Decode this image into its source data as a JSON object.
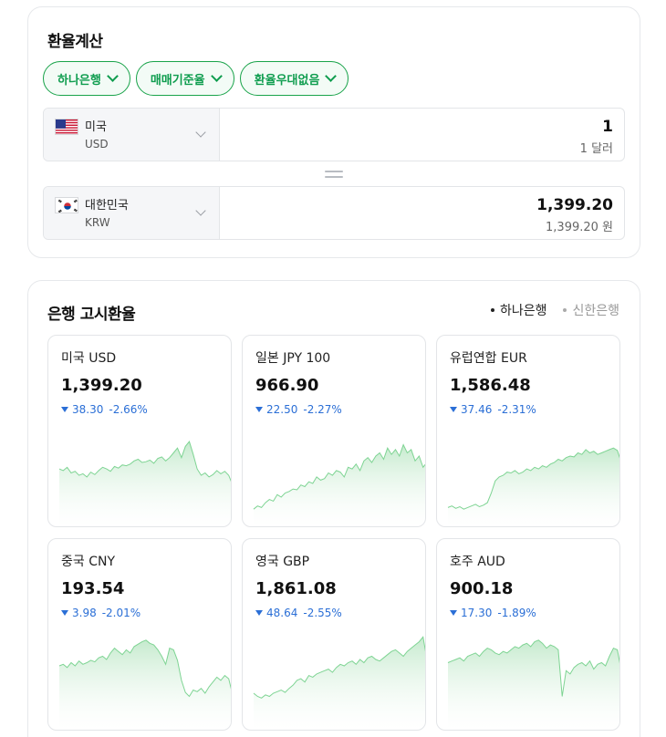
{
  "calculator": {
    "title": "환율계산",
    "chips": [
      "하나은행",
      "매매기준율",
      "환율우대없음"
    ],
    "from": {
      "name": "미국",
      "code": "USD",
      "amount": "1",
      "amount_text": "1 달러"
    },
    "to": {
      "name": "대한민국",
      "code": "KRW",
      "amount": "1,399.20",
      "amount_text": "1,399.20 원"
    }
  },
  "rates": {
    "title": "은행 고시환율",
    "banks": [
      {
        "label": "하나은행",
        "active": true
      },
      {
        "label": "신한은행",
        "active": false
      }
    ],
    "items": [
      {
        "name": "미국 USD",
        "value": "1,399.20",
        "change": "38.30",
        "pct": "-2.66%",
        "trend": [
          60,
          58,
          62,
          55,
          57,
          52,
          54,
          50,
          56,
          53,
          58,
          62,
          60,
          57,
          63,
          61,
          65,
          64,
          66,
          70,
          72,
          68,
          69,
          71,
          67,
          73,
          75,
          70,
          74,
          80,
          86,
          74,
          88,
          94,
          78,
          60,
          52,
          55,
          50,
          53,
          58,
          54,
          57,
          52,
          40
        ]
      },
      {
        "name": "일본 JPY 100",
        "value": "966.90",
        "change": "22.50",
        "pct": "-2.27%",
        "trend": [
          10,
          14,
          12,
          18,
          22,
          20,
          28,
          25,
          30,
          32,
          35,
          34,
          40,
          38,
          44,
          42,
          50,
          46,
          48,
          55,
          52,
          58,
          56,
          50,
          62,
          60,
          66,
          58,
          70,
          74,
          68,
          76,
          80,
          72,
          86,
          78,
          84,
          76,
          90,
          80,
          84,
          70,
          76,
          62,
          68
        ]
      },
      {
        "name": "유럽연합 EUR",
        "value": "1,586.48",
        "change": "37.46",
        "pct": "-2.31%",
        "trend": [
          12,
          14,
          11,
          13,
          10,
          12,
          14,
          16,
          13,
          15,
          18,
          30,
          45,
          50,
          52,
          56,
          55,
          58,
          54,
          56,
          60,
          58,
          62,
          60,
          64,
          62,
          66,
          68,
          72,
          70,
          74,
          76,
          75,
          80,
          78,
          84,
          80,
          82,
          78,
          80,
          82,
          84,
          86,
          83,
          68
        ]
      },
      {
        "name": "중국 CNY",
        "value": "193.54",
        "change": "3.98",
        "pct": "-2.01%",
        "trend": [
          68,
          70,
          66,
          72,
          68,
          74,
          70,
          72,
          75,
          73,
          78,
          80,
          76,
          84,
          90,
          86,
          82,
          88,
          84,
          92,
          95,
          98,
          100,
          96,
          94,
          88,
          80,
          70,
          90,
          88,
          75,
          50,
          35,
          30,
          38,
          36,
          40,
          34,
          42,
          48,
          54,
          50,
          56,
          52,
          32
        ]
      },
      {
        "name": "영국 GBP",
        "value": "1,861.08",
        "change": "48.64",
        "pct": "-2.55%",
        "trend": [
          34,
          30,
          28,
          32,
          30,
          34,
          36,
          38,
          35,
          40,
          44,
          50,
          52,
          48,
          56,
          54,
          58,
          60,
          62,
          64,
          60,
          66,
          70,
          68,
          72,
          74,
          70,
          76,
          72,
          78,
          80,
          76,
          74,
          78,
          82,
          86,
          88,
          84,
          80,
          86,
          90,
          94,
          98,
          104,
          76
        ]
      },
      {
        "name": "호주 AUD",
        "value": "900.18",
        "change": "17.30",
        "pct": "-1.89%",
        "trend": [
          72,
          74,
          76,
          78,
          74,
          80,
          82,
          84,
          80,
          86,
          90,
          88,
          84,
          82,
          86,
          84,
          88,
          92,
          90,
          94,
          96,
          92,
          98,
          100,
          96,
          90,
          94,
          92,
          88,
          30,
          62,
          58,
          66,
          70,
          72,
          68,
          74,
          64,
          70,
          72,
          68,
          80,
          90,
          88,
          62
        ]
      }
    ]
  }
}
